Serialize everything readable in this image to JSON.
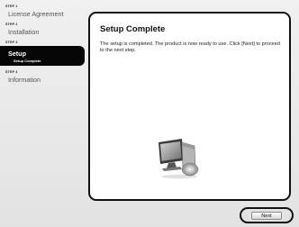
{
  "steps": [
    {
      "number": "STEP 1",
      "label": "License Agreement"
    },
    {
      "number": "STEP 2",
      "label": "Installation"
    },
    {
      "number": "STEP 3",
      "label": "Setup",
      "sub_label": "Setup Complete"
    },
    {
      "number": "STEP 4",
      "label": "Information"
    }
  ],
  "panel": {
    "title": "Setup Complete",
    "body": "The setup is completed. The product is now ready to use. Click [Next] to proceed to the next step."
  },
  "footer": {
    "next_label": "Next"
  },
  "icons": {
    "computer": "computer-with-cd-icon"
  }
}
